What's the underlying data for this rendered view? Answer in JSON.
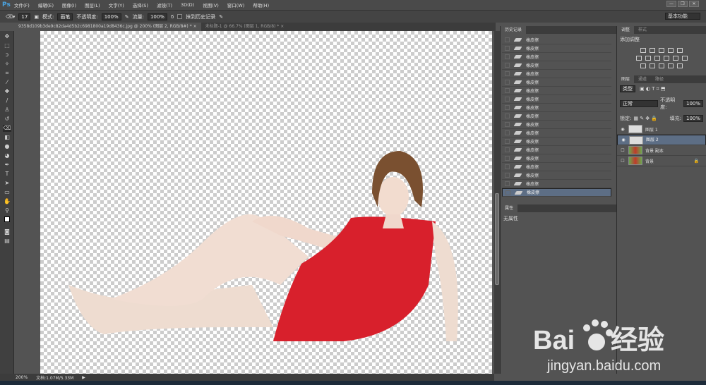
{
  "app": {
    "logo": "Ps",
    "menu": [
      "文件(F)",
      "编辑(E)",
      "图像(I)",
      "图层(L)",
      "文字(Y)",
      "选择(S)",
      "滤镜(T)",
      "3D(D)",
      "视图(V)",
      "窗口(W)",
      "帮助(H)"
    ],
    "window_buttons": [
      "—",
      "❐",
      "✕"
    ]
  },
  "options": {
    "brush_size": "17",
    "mode_label": "模式:",
    "mode_value": "画笔",
    "opacity_label": "不透明度:",
    "opacity_value": "100%",
    "flow_label": "流量:",
    "flow_value": "100%",
    "erase_history_label": "抹到历史记录",
    "workspace": "基本功能"
  },
  "tabs": [
    {
      "label": "9358d109b3de9c82da4d5b2c6981800a19d8436c.jpg @ 200% (图层 2, RGB/8#) *",
      "close": "×"
    },
    {
      "label": "未标题-1 @ 66.7% (图层 1, RGB/8) *",
      "close": "×"
    }
  ],
  "status": {
    "zoom": "200%",
    "doc": "文档:1.07M/5.33M"
  },
  "history": {
    "title": "历史记录",
    "items": [
      "橡皮擦",
      "橡皮擦",
      "橡皮擦",
      "橡皮擦",
      "橡皮擦",
      "橡皮擦",
      "橡皮擦",
      "橡皮擦",
      "橡皮擦",
      "橡皮擦",
      "橡皮擦",
      "橡皮擦",
      "橡皮擦",
      "橡皮擦",
      "橡皮擦",
      "橡皮擦",
      "橡皮擦",
      "橡皮擦",
      "橡皮擦"
    ]
  },
  "properties": {
    "title": "属性",
    "value": "无属性"
  },
  "adjustments": {
    "tabs": [
      "调整",
      "样式"
    ],
    "title": "添加调整"
  },
  "layers": {
    "tabs": [
      "图层",
      "通道",
      "路径"
    ],
    "filter": "类型",
    "blend": "正常",
    "opacity_label": "不透明度:",
    "opacity": "100%",
    "lock_label": "锁定:",
    "fill_label": "填充:",
    "fill": "100%",
    "items": [
      {
        "name": "图层 1",
        "visible": true
      },
      {
        "name": "图层 2",
        "visible": true,
        "selected": true
      },
      {
        "name": "背景 副本",
        "visible": false
      },
      {
        "name": "背景",
        "visible": false,
        "locked": true
      }
    ]
  },
  "watermark": {
    "brand": "Bai du 经验",
    "url": "jingyan.baidu.com"
  }
}
